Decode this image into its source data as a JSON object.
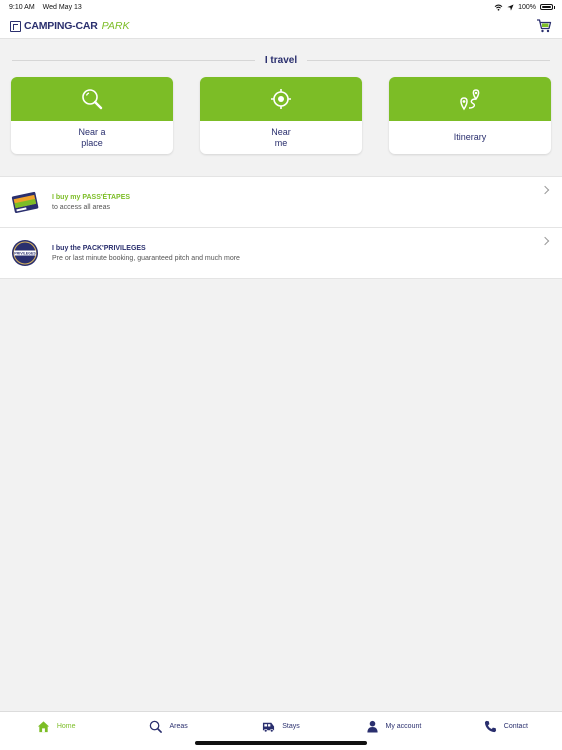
{
  "status_bar": {
    "time": "9:10 AM",
    "date": "Wed May 13",
    "battery": "100%"
  },
  "header": {
    "logo_main": "CAMPING-CAR",
    "logo_accent": "PARK"
  },
  "section": {
    "title": "I travel"
  },
  "cards": [
    {
      "label": "Near a\nplace",
      "icon": "search-icon"
    },
    {
      "label": "Near\nme",
      "icon": "crosshair-icon"
    },
    {
      "label": "Itinerary",
      "icon": "route-icon"
    }
  ],
  "promos": [
    {
      "title_prefix": "I buy my ",
      "title_accent": "PASS'ÉTAPES",
      "subtitle": "to access all areas",
      "accent_color": "#7cbd26"
    },
    {
      "title_prefix": "I buy the ",
      "title_accent": "PACK'PRIVILEGES",
      "subtitle": "Pre or last minute booking, guaranteed pitch and much more",
      "accent_color": "#2a2f6e",
      "badge_text": "PRIVILEGES"
    }
  ],
  "tabs": [
    {
      "label": "Home",
      "icon": "home-icon",
      "active": true
    },
    {
      "label": "Areas",
      "icon": "search-icon",
      "active": false
    },
    {
      "label": "Stays",
      "icon": "camper-icon",
      "active": false
    },
    {
      "label": "My account",
      "icon": "user-icon",
      "active": false
    },
    {
      "label": "Contact",
      "icon": "phone-icon",
      "active": false
    }
  ],
  "colors": {
    "brand_green": "#7cbd26",
    "brand_navy": "#2a2f6e",
    "background": "#f2f2f2"
  }
}
